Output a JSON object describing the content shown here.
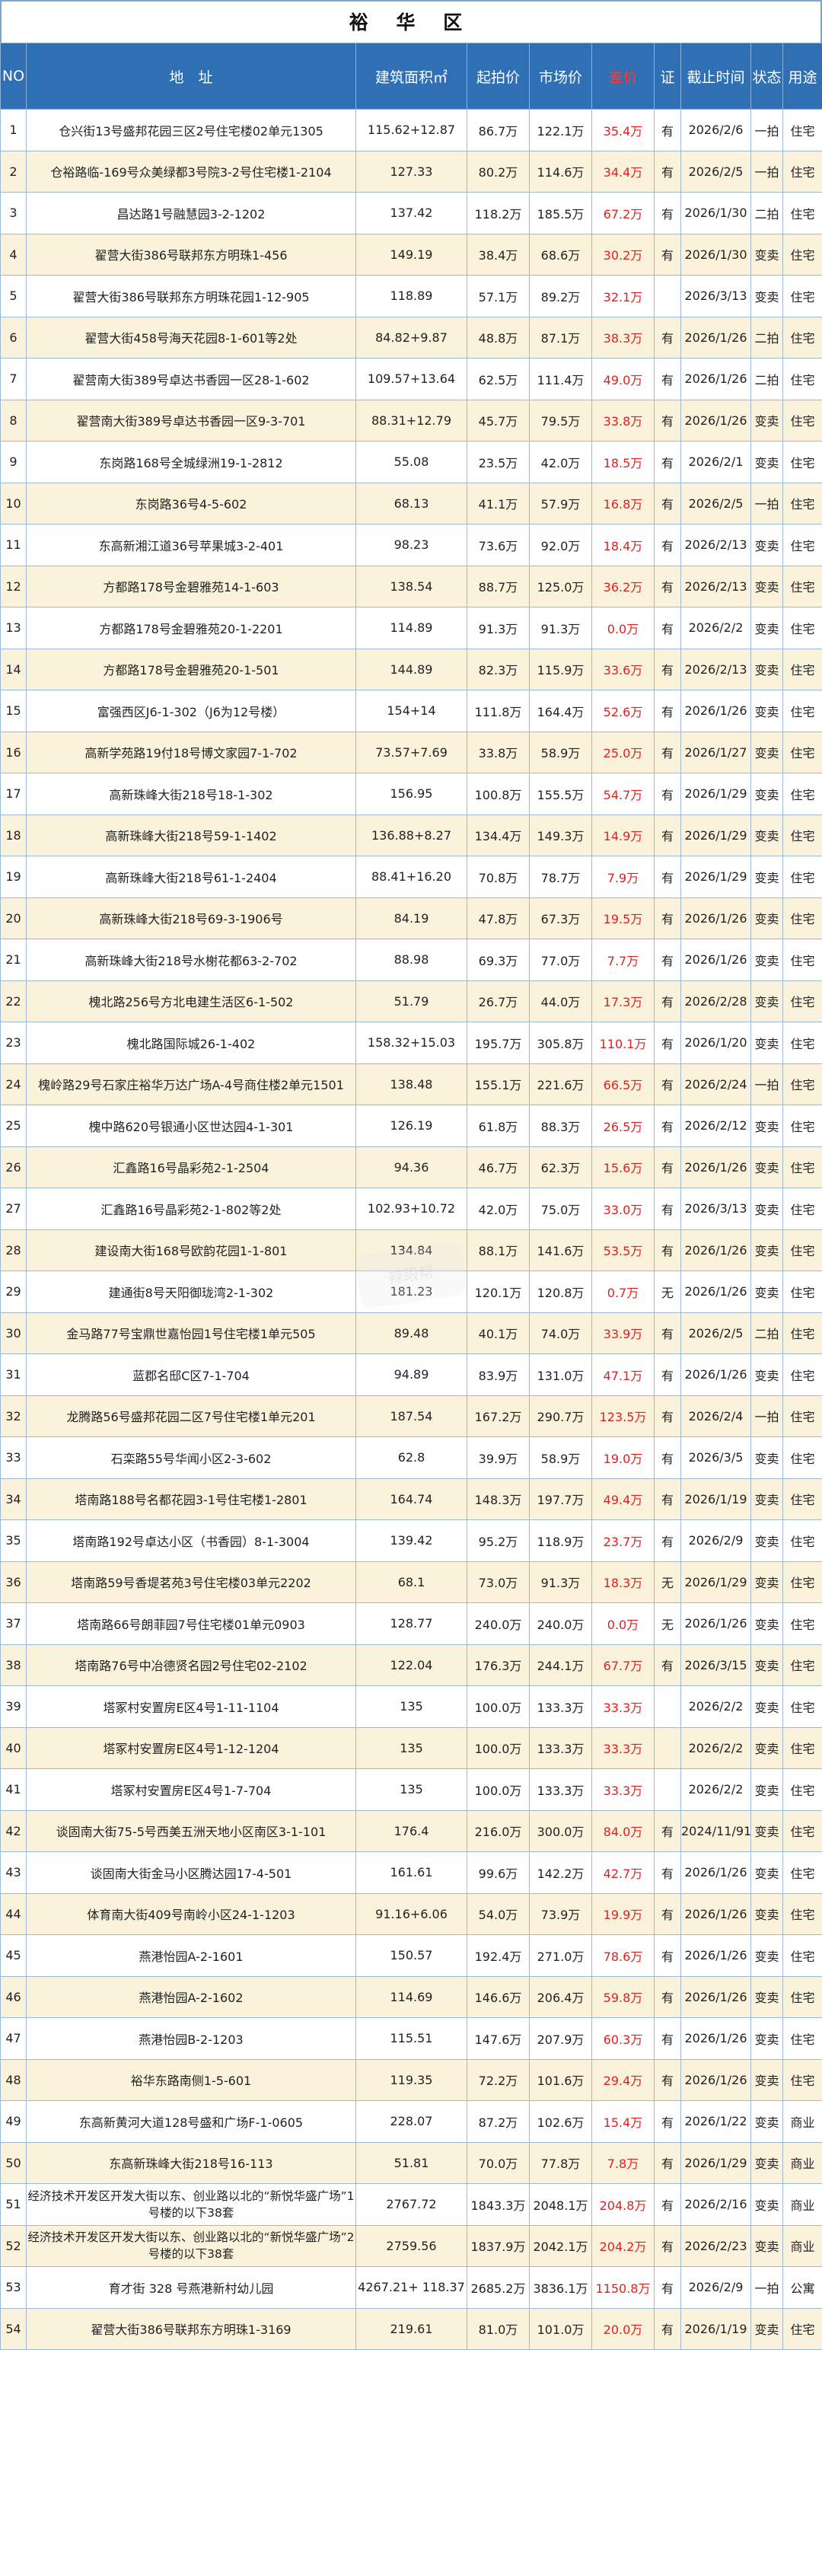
{
  "title": "裕 华 区",
  "headers": {
    "no": "NO",
    "address": "地　址",
    "area": "建筑面积㎡",
    "start": "起拍价",
    "market": "市场价",
    "diff": "差价",
    "cert": "证",
    "deadline": "截止时间",
    "status": "状态",
    "use": "用途"
  },
  "watermark": "辣眼帮",
  "colors": {
    "header_bg": "#2f6fb3",
    "alt_row_bg": "#fbf2dc",
    "diff_text": "#e02020"
  },
  "rows": [
    {
      "no": "1",
      "address": "仓兴街13号盛邦花园三区2号住宅楼02单元1305",
      "area": "115.62+12.87",
      "start": "86.7万",
      "market": "122.1万",
      "diff": "35.4万",
      "cert": "有",
      "deadline": "2026/2/6",
      "status": "一拍",
      "use": "住宅"
    },
    {
      "no": "2",
      "address": "仓裕路临-169号众美绿都3号院3-2号住宅楼1-2104",
      "area": "127.33",
      "start": "80.2万",
      "market": "114.6万",
      "diff": "34.4万",
      "cert": "有",
      "deadline": "2026/2/5",
      "status": "一拍",
      "use": "住宅"
    },
    {
      "no": "3",
      "address": "昌达路1号融慧园3-2-1202",
      "area": "137.42",
      "start": "118.2万",
      "market": "185.5万",
      "diff": "67.2万",
      "cert": "有",
      "deadline": "2026/1/30",
      "status": "二拍",
      "use": "住宅"
    },
    {
      "no": "4",
      "address": "翟营大街386号联邦东方明珠1-456",
      "area": "149.19",
      "start": "38.4万",
      "market": "68.6万",
      "diff": "30.2万",
      "cert": "有",
      "deadline": "2026/1/30",
      "status": "变卖",
      "use": "住宅"
    },
    {
      "no": "5",
      "address": "翟营大街386号联邦东方明珠花园1-12-905",
      "area": "118.89",
      "start": "57.1万",
      "market": "89.2万",
      "diff": "32.1万",
      "cert": "",
      "deadline": "2026/3/13",
      "status": "变卖",
      "use": "住宅"
    },
    {
      "no": "6",
      "address": "翟营大街458号海天花园8-1-601等2处",
      "area": "84.82+9.87",
      "start": "48.8万",
      "market": "87.1万",
      "diff": "38.3万",
      "cert": "有",
      "deadline": "2026/1/26",
      "status": "二拍",
      "use": "住宅"
    },
    {
      "no": "7",
      "address": "翟营南大街389号卓达书香园一区28-1-602",
      "area": "109.57+13.64",
      "start": "62.5万",
      "market": "111.4万",
      "diff": "49.0万",
      "cert": "有",
      "deadline": "2026/1/26",
      "status": "二拍",
      "use": "住宅"
    },
    {
      "no": "8",
      "address": "翟营南大街389号卓达书香园一区9-3-701",
      "area": "88.31+12.79",
      "start": "45.7万",
      "market": "79.5万",
      "diff": "33.8万",
      "cert": "有",
      "deadline": "2026/1/26",
      "status": "变卖",
      "use": "住宅"
    },
    {
      "no": "9",
      "address": "东岗路168号全城绿洲19-1-2812",
      "area": "55.08",
      "start": "23.5万",
      "market": "42.0万",
      "diff": "18.5万",
      "cert": "有",
      "deadline": "2026/2/1",
      "status": "变卖",
      "use": "住宅"
    },
    {
      "no": "10",
      "address": "东岗路36号4-5-602",
      "area": "68.13",
      "start": "41.1万",
      "market": "57.9万",
      "diff": "16.8万",
      "cert": "有",
      "deadline": "2026/2/5",
      "status": "一拍",
      "use": "住宅"
    },
    {
      "no": "11",
      "address": "东高新湘江道36号苹果城3-2-401",
      "area": "98.23",
      "start": "73.6万",
      "market": "92.0万",
      "diff": "18.4万",
      "cert": "有",
      "deadline": "2026/2/13",
      "status": "变卖",
      "use": "住宅"
    },
    {
      "no": "12",
      "address": "方都路178号金碧雅苑14-1-603",
      "area": "138.54",
      "start": "88.7万",
      "market": "125.0万",
      "diff": "36.2万",
      "cert": "有",
      "deadline": "2026/2/13",
      "status": "变卖",
      "use": "住宅"
    },
    {
      "no": "13",
      "address": "方都路178号金碧雅苑20-1-2201",
      "area": "114.89",
      "start": "91.3万",
      "market": "91.3万",
      "diff": "0.0万",
      "cert": "有",
      "deadline": "2026/2/2",
      "status": "变卖",
      "use": "住宅"
    },
    {
      "no": "14",
      "address": "方都路178号金碧雅苑20-1-501",
      "area": "144.89",
      "start": "82.3万",
      "market": "115.9万",
      "diff": "33.6万",
      "cert": "有",
      "deadline": "2026/2/13",
      "status": "变卖",
      "use": "住宅"
    },
    {
      "no": "15",
      "address": "富强西区J6-1-302（J6为12号楼）",
      "area": "154+14",
      "start": "111.8万",
      "market": "164.4万",
      "diff": "52.6万",
      "cert": "有",
      "deadline": "2026/1/26",
      "status": "变卖",
      "use": "住宅"
    },
    {
      "no": "16",
      "address": "高新学苑路19付18号博文家园7-1-702",
      "area": "73.57+7.69",
      "start": "33.8万",
      "market": "58.9万",
      "diff": "25.0万",
      "cert": "有",
      "deadline": "2026/1/27",
      "status": "变卖",
      "use": "住宅"
    },
    {
      "no": "17",
      "address": "高新珠峰大街218号18-1-302",
      "area": "156.95",
      "start": "100.8万",
      "market": "155.5万",
      "diff": "54.7万",
      "cert": "有",
      "deadline": "2026/1/29",
      "status": "变卖",
      "use": "住宅"
    },
    {
      "no": "18",
      "address": "高新珠峰大街218号59-1-1402",
      "area": "136.88+8.27",
      "start": "134.4万",
      "market": "149.3万",
      "diff": "14.9万",
      "cert": "有",
      "deadline": "2026/1/29",
      "status": "变卖",
      "use": "住宅"
    },
    {
      "no": "19",
      "address": "高新珠峰大街218号61-1-2404",
      "area": "88.41+16.20",
      "start": "70.8万",
      "market": "78.7万",
      "diff": "7.9万",
      "cert": "有",
      "deadline": "2026/1/29",
      "status": "变卖",
      "use": "住宅"
    },
    {
      "no": "20",
      "address": "高新珠峰大街218号69-3-1906号",
      "area": "84.19",
      "start": "47.8万",
      "market": "67.3万",
      "diff": "19.5万",
      "cert": "有",
      "deadline": "2026/1/26",
      "status": "变卖",
      "use": "住宅"
    },
    {
      "no": "21",
      "address": "高新珠峰大街218号水榭花都63-2-702",
      "area": "88.98",
      "start": "69.3万",
      "market": "77.0万",
      "diff": "7.7万",
      "cert": "有",
      "deadline": "2026/1/26",
      "status": "变卖",
      "use": "住宅"
    },
    {
      "no": "22",
      "address": "槐北路256号方北电建生活区6-1-502",
      "area": "51.79",
      "start": "26.7万",
      "market": "44.0万",
      "diff": "17.3万",
      "cert": "有",
      "deadline": "2026/2/28",
      "status": "变卖",
      "use": "住宅"
    },
    {
      "no": "23",
      "address": "槐北路国际城26-1-402",
      "area": "158.32+15.03",
      "start": "195.7万",
      "market": "305.8万",
      "diff": "110.1万",
      "cert": "有",
      "deadline": "2026/1/20",
      "status": "变卖",
      "use": "住宅"
    },
    {
      "no": "24",
      "address": "槐岭路29号石家庄裕华万达广场A-4号商住楼2单元1501",
      "area": "138.48",
      "start": "155.1万",
      "market": "221.6万",
      "diff": "66.5万",
      "cert": "有",
      "deadline": "2026/2/24",
      "status": "一拍",
      "use": "住宅"
    },
    {
      "no": "25",
      "address": "槐中路620号银通小区世达园4-1-301",
      "area": "126.19",
      "start": "61.8万",
      "market": "88.3万",
      "diff": "26.5万",
      "cert": "有",
      "deadline": "2026/2/12",
      "status": "变卖",
      "use": "住宅"
    },
    {
      "no": "26",
      "address": "汇鑫路16号晶彩苑2-1-2504",
      "area": "94.36",
      "start": "46.7万",
      "market": "62.3万",
      "diff": "15.6万",
      "cert": "有",
      "deadline": "2026/1/26",
      "status": "变卖",
      "use": "住宅"
    },
    {
      "no": "27",
      "address": "汇鑫路16号晶彩苑2-1-802等2处",
      "area": "102.93+10.72",
      "start": "42.0万",
      "market": "75.0万",
      "diff": "33.0万",
      "cert": "有",
      "deadline": "2026/3/13",
      "status": "变卖",
      "use": "住宅"
    },
    {
      "no": "28",
      "address": "建设南大街168号欧韵花园1-1-801",
      "area": "134.84",
      "start": "88.1万",
      "market": "141.6万",
      "diff": "53.5万",
      "cert": "有",
      "deadline": "2026/1/26",
      "status": "变卖",
      "use": "住宅"
    },
    {
      "no": "29",
      "address": "建通街8号天阳御珑湾2-1-302",
      "area": "181.23",
      "start": "120.1万",
      "market": "120.8万",
      "diff": "0.7万",
      "cert": "无",
      "deadline": "2026/1/26",
      "status": "变卖",
      "use": "住宅"
    },
    {
      "no": "30",
      "address": "金马路77号宝鼎世嘉怡园1号住宅楼1单元505",
      "area": "89.48",
      "start": "40.1万",
      "market": "74.0万",
      "diff": "33.9万",
      "cert": "有",
      "deadline": "2026/2/5",
      "status": "二拍",
      "use": "住宅"
    },
    {
      "no": "31",
      "address": "蓝郡名邸C区7-1-704",
      "area": "94.89",
      "start": "83.9万",
      "market": "131.0万",
      "diff": "47.1万",
      "cert": "有",
      "deadline": "2026/1/26",
      "status": "变卖",
      "use": "住宅"
    },
    {
      "no": "32",
      "address": "龙腾路56号盛邦花园二区7号住宅楼1单元201",
      "area": "187.54",
      "start": "167.2万",
      "market": "290.7万",
      "diff": "123.5万",
      "cert": "有",
      "deadline": "2026/2/4",
      "status": "一拍",
      "use": "住宅"
    },
    {
      "no": "33",
      "address": "石栾路55号华闻小区2-3-602",
      "area": "62.8",
      "start": "39.9万",
      "market": "58.9万",
      "diff": "19.0万",
      "cert": "有",
      "deadline": "2026/3/5",
      "status": "变卖",
      "use": "住宅"
    },
    {
      "no": "34",
      "address": "塔南路188号名都花园3-1号住宅楼1-2801",
      "area": "164.74",
      "start": "148.3万",
      "market": "197.7万",
      "diff": "49.4万",
      "cert": "有",
      "deadline": "2026/1/19",
      "status": "变卖",
      "use": "住宅"
    },
    {
      "no": "35",
      "address": "塔南路192号卓达小区（书香园）8-1-3004",
      "area": "139.42",
      "start": "95.2万",
      "market": "118.9万",
      "diff": "23.7万",
      "cert": "有",
      "deadline": "2026/2/9",
      "status": "变卖",
      "use": "住宅"
    },
    {
      "no": "36",
      "address": "塔南路59号香堤茗苑3号住宅楼03单元2202",
      "area": "68.1",
      "start": "73.0万",
      "market": "91.3万",
      "diff": "18.3万",
      "cert": "无",
      "deadline": "2026/1/29",
      "status": "变卖",
      "use": "住宅"
    },
    {
      "no": "37",
      "address": "塔南路66号朗菲园7号住宅楼01单元0903",
      "area": "128.77",
      "start": "240.0万",
      "market": "240.0万",
      "diff": "0.0万",
      "cert": "无",
      "deadline": "2026/1/26",
      "status": "变卖",
      "use": "住宅"
    },
    {
      "no": "38",
      "address": "塔南路76号中冶德贤名园2号住宅02-2102",
      "area": "122.04",
      "start": "176.3万",
      "market": "244.1万",
      "diff": "67.7万",
      "cert": "有",
      "deadline": "2026/3/15",
      "status": "变卖",
      "use": "住宅"
    },
    {
      "no": "39",
      "address": "塔冢村安置房E区4号1-11-1104",
      "area": "135",
      "start": "100.0万",
      "market": "133.3万",
      "diff": "33.3万",
      "cert": "",
      "deadline": "2026/2/2",
      "status": "变卖",
      "use": "住宅"
    },
    {
      "no": "40",
      "address": "塔冢村安置房E区4号1-12-1204",
      "area": "135",
      "start": "100.0万",
      "market": "133.3万",
      "diff": "33.3万",
      "cert": "",
      "deadline": "2026/2/2",
      "status": "变卖",
      "use": "住宅"
    },
    {
      "no": "41",
      "address": "塔冢村安置房E区4号1-7-704",
      "area": "135",
      "start": "100.0万",
      "market": "133.3万",
      "diff": "33.3万",
      "cert": "",
      "deadline": "2026/2/2",
      "status": "变卖",
      "use": "住宅"
    },
    {
      "no": "42",
      "address": "谈固南大街75-5号西美五洲天地小区南区3-1-101",
      "area": "176.4",
      "start": "216.0万",
      "market": "300.0万",
      "diff": "84.0万",
      "cert": "有",
      "deadline": "2024/11/91",
      "status": "变卖",
      "use": "住宅"
    },
    {
      "no": "43",
      "address": "谈固南大街金马小区腾达园17-4-501",
      "area": "161.61",
      "start": "99.6万",
      "market": "142.2万",
      "diff": "42.7万",
      "cert": "有",
      "deadline": "2026/1/26",
      "status": "变卖",
      "use": "住宅"
    },
    {
      "no": "44",
      "address": "体育南大街409号南岭小区24-1-1203",
      "area": "91.16+6.06",
      "start": "54.0万",
      "market": "73.9万",
      "diff": "19.9万",
      "cert": "有",
      "deadline": "2026/1/26",
      "status": "变卖",
      "use": "住宅"
    },
    {
      "no": "45",
      "address": "燕港怡园A-2-1601",
      "area": "150.57",
      "start": "192.4万",
      "market": "271.0万",
      "diff": "78.6万",
      "cert": "有",
      "deadline": "2026/1/26",
      "status": "变卖",
      "use": "住宅"
    },
    {
      "no": "46",
      "address": "燕港怡园A-2-1602",
      "area": "114.69",
      "start": "146.6万",
      "market": "206.4万",
      "diff": "59.8万",
      "cert": "有",
      "deadline": "2026/1/26",
      "status": "变卖",
      "use": "住宅"
    },
    {
      "no": "47",
      "address": "燕港怡园B-2-1203",
      "area": "115.51",
      "start": "147.6万",
      "market": "207.9万",
      "diff": "60.3万",
      "cert": "有",
      "deadline": "2026/1/26",
      "status": "变卖",
      "use": "住宅"
    },
    {
      "no": "48",
      "address": "裕华东路南侧1-5-601",
      "area": "119.35",
      "start": "72.2万",
      "market": "101.6万",
      "diff": "29.4万",
      "cert": "有",
      "deadline": "2026/1/26",
      "status": "变卖",
      "use": "住宅"
    },
    {
      "no": "49",
      "address": "东高新黄河大道128号盛和广场F-1-0605",
      "area": "228.07",
      "start": "87.2万",
      "market": "102.6万",
      "diff": "15.4万",
      "cert": "有",
      "deadline": "2026/1/22",
      "status": "变卖",
      "use": "商业"
    },
    {
      "no": "50",
      "address": "东高新珠峰大街218号16-113",
      "area": "51.81",
      "start": "70.0万",
      "market": "77.8万",
      "diff": "7.8万",
      "cert": "有",
      "deadline": "2026/1/29",
      "status": "变卖",
      "use": "商业"
    },
    {
      "no": "51",
      "address": "经济技术开发区开发大街以东、创业路以北的“新悦华盛广场”1号楼的以下38套",
      "area": "2767.72",
      "start": "1843.3万",
      "market": "2048.1万",
      "diff": "204.8万",
      "cert": "有",
      "deadline": "2026/2/16",
      "status": "变卖",
      "use": "商业"
    },
    {
      "no": "52",
      "address": "经济技术开发区开发大街以东、创业路以北的“新悦华盛广场”2号楼的以下38套",
      "area": "2759.56",
      "start": "1837.9万",
      "market": "2042.1万",
      "diff": "204.2万",
      "cert": "有",
      "deadline": "2026/2/23",
      "status": "变卖",
      "use": "商业"
    },
    {
      "no": "53",
      "address": "育才街 328 号燕港新村幼儿园",
      "area": "4267.21+ 118.37",
      "start": "2685.2万",
      "market": "3836.1万",
      "diff": "1150.8万",
      "cert": "有",
      "deadline": "2026/2/9",
      "status": "一拍",
      "use": "公寓"
    },
    {
      "no": "54",
      "address": "翟营大街386号联邦东方明珠1-3169",
      "area": "219.61",
      "start": "81.0万",
      "market": "101.0万",
      "diff": "20.0万",
      "cert": "有",
      "deadline": "2026/1/19",
      "status": "变卖",
      "use": "住宅"
    }
  ]
}
